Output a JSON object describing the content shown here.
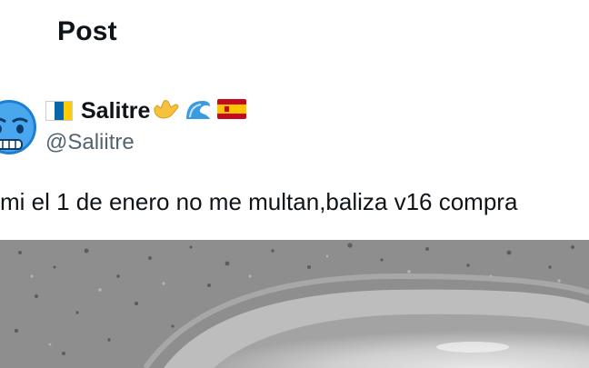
{
  "header": {
    "title": "Post"
  },
  "post": {
    "author": {
      "display_name": "Salitre",
      "handle": "@Saliitre",
      "avatar_icon": "cold-face-emoji-avatar",
      "name_emojis": [
        "canary-islands-flag",
        "call-me-hand-emoji",
        "water-wave-emoji",
        "spain-flag"
      ]
    },
    "text": "mi el 1 de enero no me multan,baliza v16 compra",
    "media": {
      "type": "photo",
      "description_icon": "concrete-surface-photo"
    }
  },
  "colors": {
    "text_primary": "#0f1419",
    "text_secondary": "#536471",
    "background": "#ffffff"
  }
}
